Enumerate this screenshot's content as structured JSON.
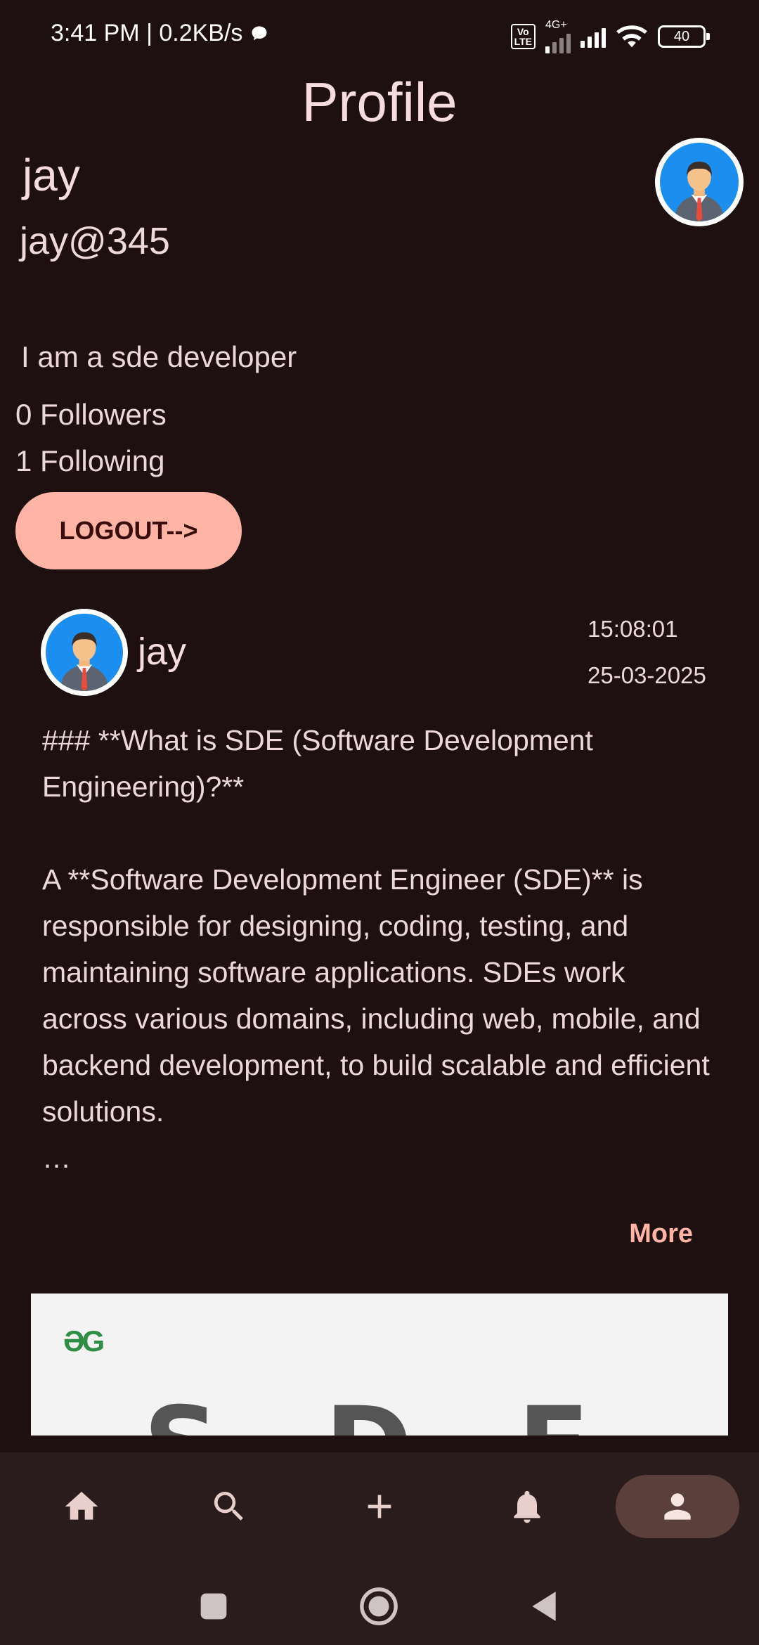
{
  "status_bar": {
    "time_speed": "3:41 PM | 0.2KB/s",
    "network_label": "4G+",
    "volte_label": "Vo\nLTE",
    "battery": "40"
  },
  "header": {
    "title": "Profile"
  },
  "profile": {
    "name": "jay",
    "handle": "jay@345",
    "bio": "I am a sde developer",
    "followers": "0 Followers",
    "following": "1 Following",
    "logout_label": "LOGOUT-->"
  },
  "post": {
    "author": "jay",
    "time": "15:08:01",
    "date": "25-03-2025",
    "body": "### **What is SDE (Software Development Engineering)?**\n\nA **Software Development Engineer (SDE)** is responsible for designing, coding, testing, and maintaining software applications. SDEs work across various domains, including web, mobile, and backend development, to build scalable and efficient solutions.\n…",
    "more_label": "More",
    "image": {
      "logo_text": "ƏG",
      "letters": "SDE"
    }
  },
  "bottom_nav": {
    "items": [
      {
        "icon": "home-icon"
      },
      {
        "icon": "search-icon"
      },
      {
        "icon": "add-icon"
      },
      {
        "icon": "bell-icon"
      },
      {
        "icon": "person-icon",
        "active": true
      }
    ]
  },
  "colors": {
    "background": "#1e1010",
    "accent": "#ffb4a6",
    "nav_bar": "#2a1c1c",
    "nav_active": "#5a3f3b",
    "avatar_bg": "#1c8ef0"
  }
}
